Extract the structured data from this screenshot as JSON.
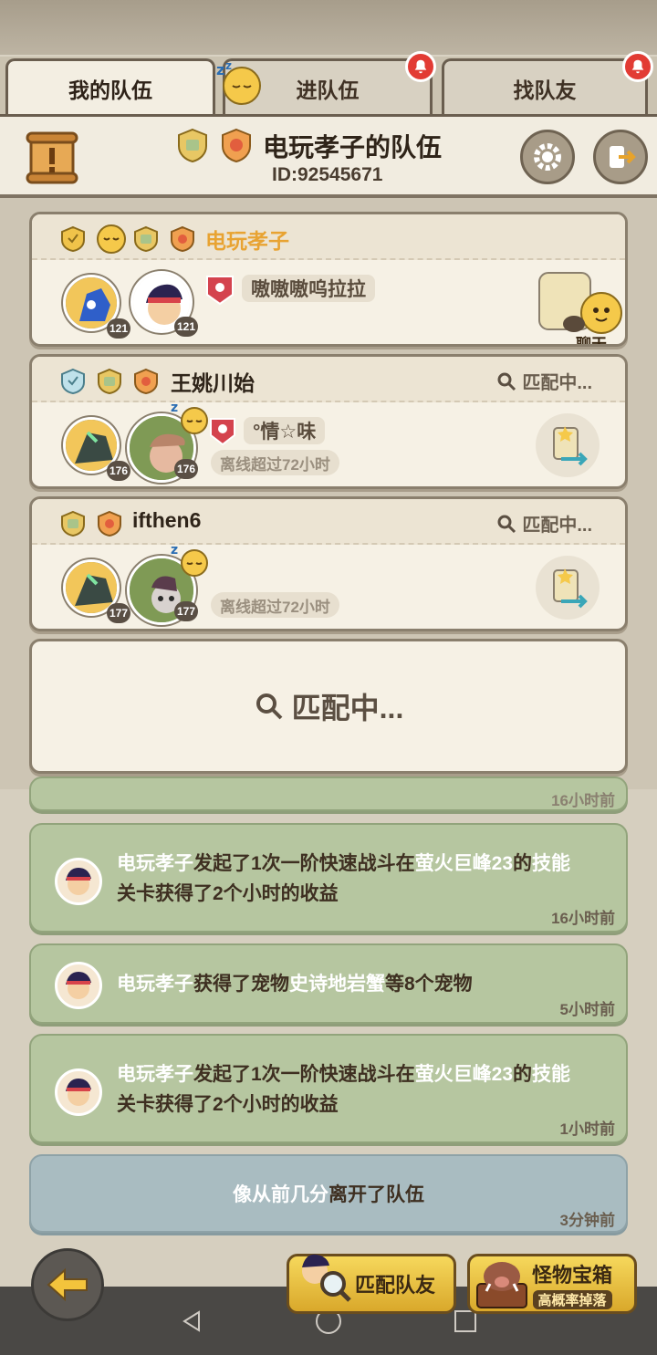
{
  "tabs": [
    {
      "label": "我的队伍",
      "active": true
    },
    {
      "label": "进队伍",
      "active": false,
      "notification": true
    },
    {
      "label": "找队友",
      "active": false,
      "notification": true
    }
  ],
  "header": {
    "team_title": "电玩孝子的队伍",
    "team_id": "ID:92545671"
  },
  "members": [
    {
      "name": "电玩孝子",
      "is_leader": true,
      "pet_level": "121",
      "player_level": "121",
      "title_pill": "嗷嗷嗷呜拉拉",
      "action_label": "聊天"
    },
    {
      "name": "王姚川始",
      "matching_label": "匹配中...",
      "pet_level": "176",
      "player_level": "176",
      "title_pill": "°情☆味",
      "status": "离线超过72小时"
    },
    {
      "name": "ifthen6",
      "matching_label": "匹配中...",
      "pet_level": "177",
      "player_level": "177",
      "status": "离线超过72小时"
    }
  ],
  "empty_slot": {
    "matching_label": "匹配中..."
  },
  "feed": {
    "partial_time": "16小时前",
    "items": [
      {
        "segments": [
          {
            "t": "电玩孝子",
            "hl": false
          },
          {
            "t": "发起了1次一阶快速战斗在",
            "hl": true
          },
          {
            "t": "萤火巨峰23",
            "hl": false
          },
          {
            "t": "的",
            "hl": true
          },
          {
            "t": "技能",
            "hl": false
          },
          {
            "t": "关卡获得了2个小时的收益",
            "hl": true
          }
        ],
        "time": "16小时前"
      },
      {
        "segments": [
          {
            "t": "电玩孝子",
            "hl": false
          },
          {
            "t": "获得了宠物",
            "hl": true
          },
          {
            "t": "史诗地岩蟹",
            "hl": false
          },
          {
            "t": "等8个宠物",
            "hl": true
          }
        ],
        "time": "5小时前"
      },
      {
        "segments": [
          {
            "t": "电玩孝子",
            "hl": false
          },
          {
            "t": "发起了1次一阶快速战斗在",
            "hl": true
          },
          {
            "t": "萤火巨峰23",
            "hl": false
          },
          {
            "t": "的",
            "hl": true
          },
          {
            "t": "技能",
            "hl": false
          },
          {
            "t": "关卡获得了2个小时的收益",
            "hl": true
          }
        ],
        "time": "1小时前"
      },
      {
        "segments": [
          {
            "t": "像从前几分",
            "hl": false
          },
          {
            "t": "离开了队伍",
            "hl": true
          }
        ],
        "time": "3分钟前"
      }
    ]
  },
  "bottom": {
    "match_button": "匹配队友",
    "chest_button": "怪物宝箱",
    "chest_sub": "高概率掉落"
  },
  "colors": {
    "leader_name": "#e8a332",
    "feed_green": "#b6c6a0",
    "feed_blue": "#a9bcc1",
    "notification": "#e23b34"
  },
  "icons": [
    "bell-icon",
    "sleep-emoji-icon",
    "scroll-icon",
    "gear-icon",
    "exit-icon",
    "search-icon",
    "chat-bubble-icon",
    "swap-icon",
    "back-arrow-icon",
    "magnifier-icon",
    "boar-chest-icon"
  ]
}
